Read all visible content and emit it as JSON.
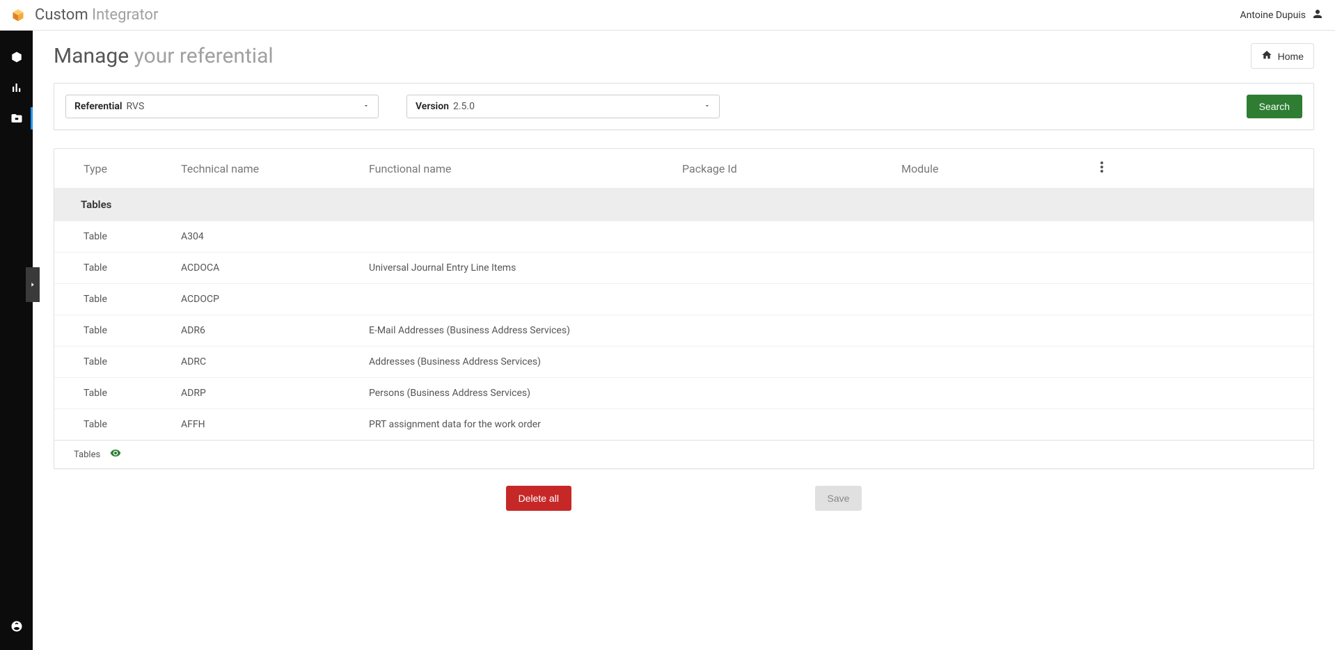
{
  "header": {
    "app_name_strong": "Custom",
    "app_name_light": "Integrator",
    "user_name": "Antoine Dupuis"
  },
  "page_title": {
    "strong": "Manage",
    "light": "your referential"
  },
  "home_button": "Home",
  "filters": {
    "referential_label": "Referential",
    "referential_value": "RVS",
    "version_label": "Version",
    "version_value": "2.5.0",
    "search_label": "Search"
  },
  "table": {
    "columns": {
      "type": "Type",
      "technical_name": "Technical name",
      "functional_name": "Functional name",
      "package_id": "Package Id",
      "module": "Module"
    },
    "group_label": "Tables",
    "rows": [
      {
        "type": "Table",
        "tech": "A304",
        "func": "",
        "pkg": "",
        "mod": ""
      },
      {
        "type": "Table",
        "tech": "ACDOCA",
        "func": "Universal Journal Entry Line Items",
        "pkg": "",
        "mod": ""
      },
      {
        "type": "Table",
        "tech": "ACDOCP",
        "func": "",
        "pkg": "",
        "mod": ""
      },
      {
        "type": "Table",
        "tech": "ADR6",
        "func": "E-Mail Addresses (Business Address Services)",
        "pkg": "",
        "mod": ""
      },
      {
        "type": "Table",
        "tech": "ADRC",
        "func": "Addresses (Business Address Services)",
        "pkg": "",
        "mod": ""
      },
      {
        "type": "Table",
        "tech": "ADRP",
        "func": "Persons (Business Address Services)",
        "pkg": "",
        "mod": ""
      },
      {
        "type": "Table",
        "tech": "AFFH",
        "func": "PRT assignment data for the work order",
        "pkg": "",
        "mod": ""
      }
    ],
    "footer_label": "Tables"
  },
  "actions": {
    "delete_all": "Delete all",
    "save": "Save"
  }
}
